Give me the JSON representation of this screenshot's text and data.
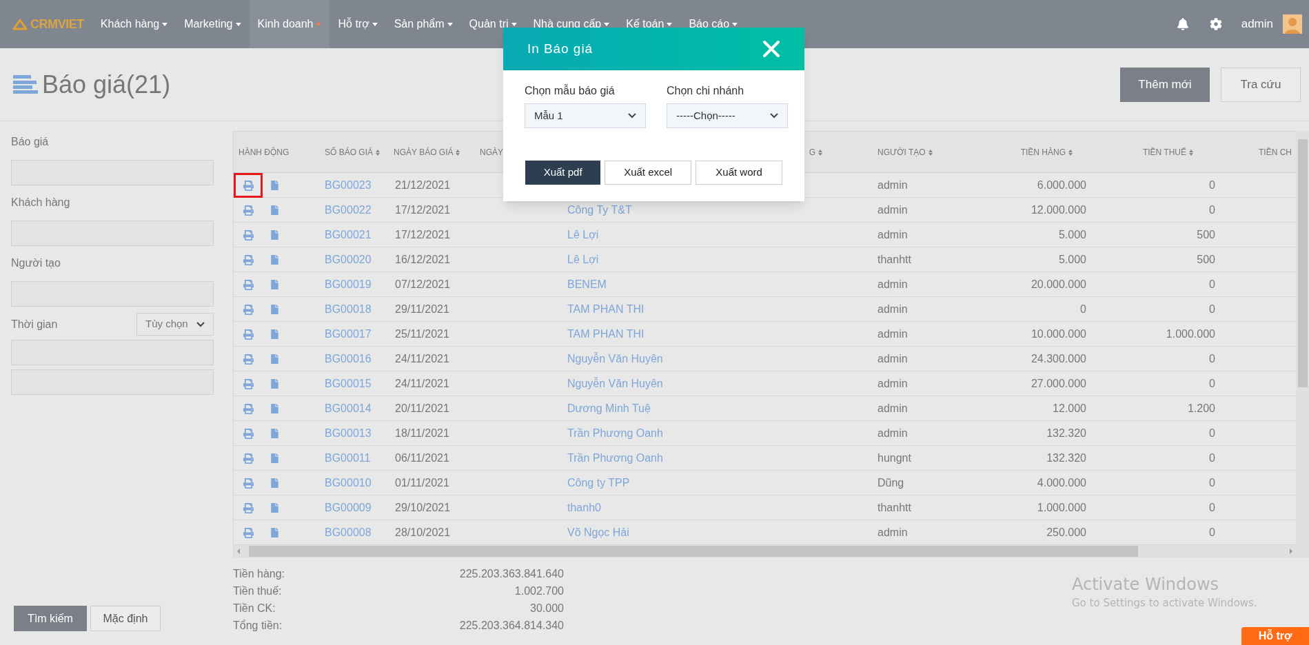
{
  "navbar": {
    "logo": "CRMVIET",
    "menu": [
      {
        "label": "Khách hàng",
        "selected": false
      },
      {
        "label": "Marketing",
        "selected": false
      },
      {
        "label": "Kinh doanh",
        "selected": true
      },
      {
        "label": "Hỗ trợ",
        "selected": false
      },
      {
        "label": "Sản phẩm",
        "selected": false
      },
      {
        "label": "Quản trị",
        "selected": false
      },
      {
        "label": "Nhà cung cấp",
        "selected": false
      },
      {
        "label": "Kế toán",
        "selected": false
      },
      {
        "label": "Báo cáo",
        "selected": false
      }
    ],
    "user": "admin"
  },
  "page": {
    "title": "Báo giá(21)",
    "buttons": [
      "Thêm mới",
      "Tra cứu"
    ]
  },
  "filters": {
    "fields": [
      {
        "label": "Báo giá"
      },
      {
        "label": "Khách hàng"
      },
      {
        "label": "Người tạo"
      }
    ],
    "time": {
      "label": "Thời gian",
      "select": "Tùy chọn"
    },
    "buttons": [
      "Tìm kiếm",
      "Mặc định"
    ]
  },
  "table": {
    "columns": [
      "HÀNH ĐỘNG",
      "SỐ BÁO GIÁ",
      "NGÀY BÁO GIÁ",
      "NGÀY",
      "G",
      "NGƯỜI TẠO",
      "TIỀN HÀNG",
      "TIỀN THUẾ",
      "TIỀN CH"
    ],
    "rows": [
      {
        "highlighted": true,
        "code": "BG00023",
        "date": "21/12/2021",
        "creator": "admin",
        "amount": "6.000.000",
        "tax": "0"
      },
      {
        "highlighted": false,
        "code": "BG00022",
        "date": "17/12/2021",
        "customer": "Công Ty T&T",
        "creator": "admin",
        "amount": "12.000.000",
        "tax": "0"
      },
      {
        "highlighted": false,
        "code": "BG00021",
        "date": "17/12/2021",
        "customer": "Lê Lợi",
        "creator": "admin",
        "amount": "5.000",
        "tax": "500"
      },
      {
        "highlighted": false,
        "code": "BG00020",
        "date": "16/12/2021",
        "customer": "Lê Lợi",
        "creator": "thanhtt",
        "amount": "5.000",
        "tax": "500"
      },
      {
        "highlighted": false,
        "code": "BG00019",
        "date": "07/12/2021",
        "customer": "BENEM",
        "creator": "admin",
        "amount": "20.000.000",
        "tax": "0"
      },
      {
        "highlighted": false,
        "code": "BG00018",
        "date": "29/11/2021",
        "customer": "TAM PHAN THI",
        "creator": "admin",
        "amount": "0",
        "tax": "0"
      },
      {
        "highlighted": false,
        "code": "BG00017",
        "date": "25/11/2021",
        "customer": "TAM PHAN THI",
        "creator": "admin",
        "amount": "10.000.000",
        "tax": "1.000.000"
      },
      {
        "highlighted": false,
        "code": "BG00016",
        "date": "24/11/2021",
        "customer": "Nguyễn Văn Huyên",
        "creator": "admin",
        "amount": "24.300.000",
        "tax": "0"
      },
      {
        "highlighted": false,
        "code": "BG00015",
        "date": "24/11/2021",
        "customer": "Nguyễn Văn Huyên",
        "creator": "admin",
        "amount": "27.000.000",
        "tax": "0"
      },
      {
        "highlighted": false,
        "code": "BG00014",
        "date": "20/11/2021",
        "customer": "Dương Minh Tuệ",
        "creator": "admin",
        "amount": "12.000",
        "tax": "1.200"
      },
      {
        "highlighted": false,
        "code": "BG00013",
        "date": "18/11/2021",
        "customer": "Trần Phương Oanh",
        "creator": "admin",
        "amount": "132.320",
        "tax": "0"
      },
      {
        "highlighted": false,
        "code": "BG00011",
        "date": "06/11/2021",
        "customer": "Trần Phương Oanh",
        "creator": "hungnt",
        "amount": "132.320",
        "tax": "0"
      },
      {
        "highlighted": false,
        "code": "BG00010",
        "date": "01/11/2021",
        "customer": "Công ty TPP",
        "creator": "Dũng",
        "amount": "4.000.000",
        "tax": "0"
      },
      {
        "highlighted": false,
        "code": "BG00009",
        "date": "29/10/2021",
        "customer": "thanh0",
        "creator": "thanhtt",
        "amount": "1.000.000",
        "tax": "0"
      },
      {
        "highlighted": false,
        "code": "BG00008",
        "date": "28/10/2021",
        "customer": "Võ Ngọc Hải",
        "creator": "admin",
        "amount": "250.000",
        "tax": "0"
      }
    ]
  },
  "totals": [
    {
      "label": "Tiền hàng:",
      "value": "225.203.363.841.640"
    },
    {
      "label": "Tiền thuế:",
      "value": "1.002.700"
    },
    {
      "label": "Tiền CK:",
      "value": "30.000"
    },
    {
      "label": "Tổng tiền:",
      "value": "225.203.364.814.340"
    }
  ],
  "modal": {
    "title": "In Báo giá",
    "template": {
      "label": "Chọn mẫu báo giá",
      "value": "Mẫu 1"
    },
    "branch": {
      "label": "Chọn chi nhánh",
      "value": "-----Chọn-----"
    },
    "buttons": [
      {
        "label": "Xuất pdf",
        "kind": "primary"
      },
      {
        "label": "Xuất excel",
        "kind": "default"
      },
      {
        "label": "Xuất word",
        "kind": "default"
      }
    ]
  },
  "activation": {
    "title": "Activate Windows",
    "text": "Go to Settings to activate Windows."
  },
  "support_button": "Hỗ trợ"
}
